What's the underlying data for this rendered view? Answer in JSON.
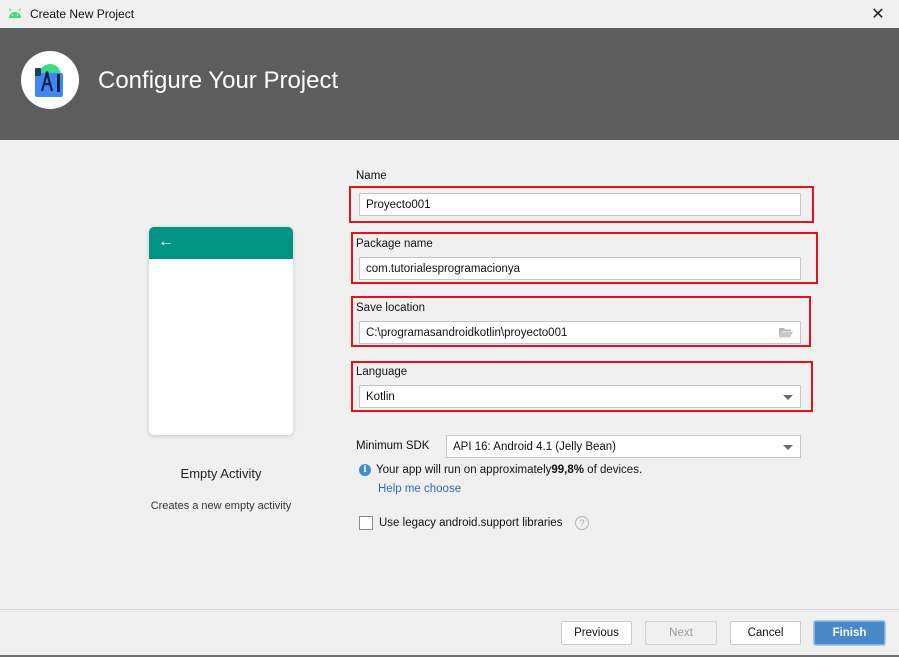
{
  "window": {
    "title": "Create New Project",
    "close_icon": "close-icon"
  },
  "header": {
    "heading": "Configure Your Project",
    "logo_icon": "android-studio-logo"
  },
  "template_preview": {
    "back_icon": "arrow-left-icon",
    "toolbar_color": "#009485",
    "title": "Empty Activity",
    "description": "Creates a new empty activity"
  },
  "form": {
    "name": {
      "label": "Name",
      "value": "Proyecto001"
    },
    "package_name": {
      "label": "Package name",
      "value": "com.tutorialesprogramacionya"
    },
    "save_location": {
      "label": "Save location",
      "value": "C:\\programasandroidkotlin\\proyecto001",
      "browse_icon": "folder-open-icon"
    },
    "language": {
      "label": "Language",
      "value": "Kotlin"
    },
    "minimum_sdk": {
      "label": "Minimum SDK",
      "value": "API 16: Android 4.1 (Jelly Bean)"
    },
    "info": {
      "prefix": "Your app will run on approximately ",
      "percent": "99,8%",
      "suffix": " of devices.",
      "help_link": "Help me choose"
    },
    "legacy_support": {
      "label": "Use legacy android.support libraries",
      "checked": false
    }
  },
  "highlight_color": "#e0141e",
  "buttons": {
    "previous": "Previous",
    "next": "Next",
    "cancel": "Cancel",
    "finish": "Finish"
  }
}
